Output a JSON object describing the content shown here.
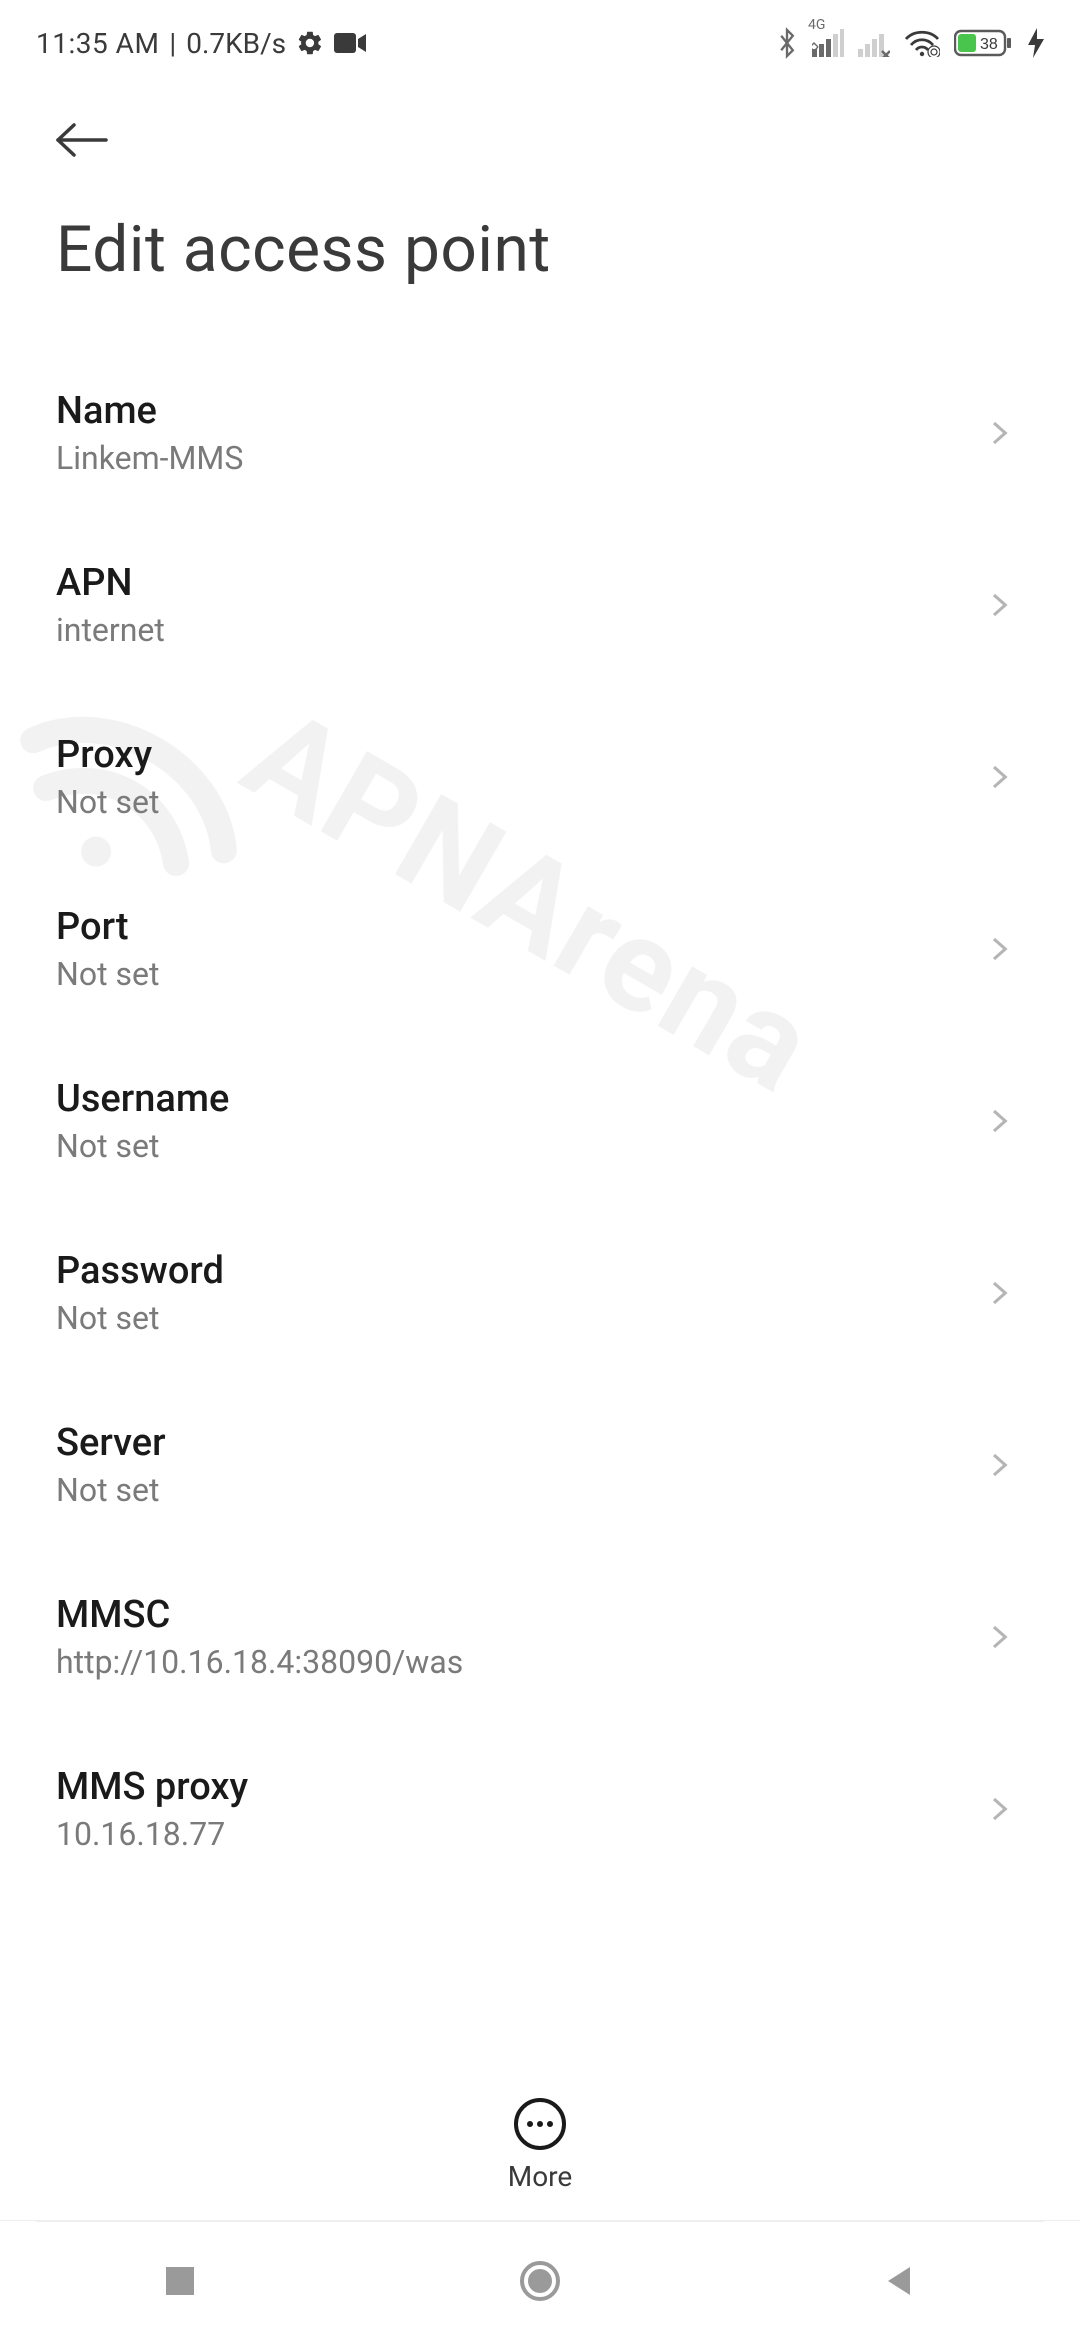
{
  "status": {
    "time": "11:35 AM",
    "separator": "|",
    "data_rate": "0.7KB/s",
    "network_label": "4G",
    "battery_percent": "38"
  },
  "header": {
    "title": "Edit access point"
  },
  "settings": [
    {
      "label": "Name",
      "value": "Linkem-MMS"
    },
    {
      "label": "APN",
      "value": "internet"
    },
    {
      "label": "Proxy",
      "value": "Not set"
    },
    {
      "label": "Port",
      "value": "Not set"
    },
    {
      "label": "Username",
      "value": "Not set"
    },
    {
      "label": "Password",
      "value": "Not set"
    },
    {
      "label": "Server",
      "value": "Not set"
    },
    {
      "label": "MMSC",
      "value": "http://10.16.18.4:38090/was"
    },
    {
      "label": "MMS proxy",
      "value": "10.16.18.77"
    }
  ],
  "bottom": {
    "more_label": "More"
  },
  "watermark": {
    "text": "APNArena"
  }
}
